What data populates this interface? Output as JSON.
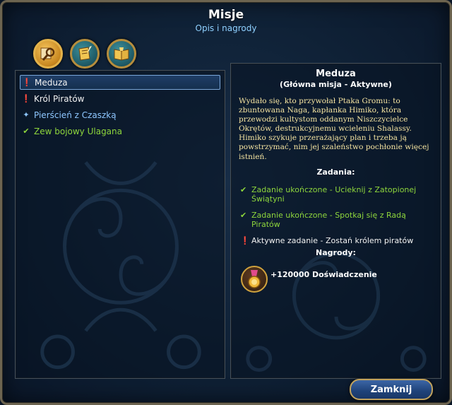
{
  "window": {
    "title": "Misje",
    "subtitle": "Opis i nagrody"
  },
  "tabs": [
    {
      "icon": "magnifier-map-icon",
      "active": true
    },
    {
      "icon": "scroll-quill-icon",
      "active": false
    },
    {
      "icon": "open-book-icon",
      "active": false
    }
  ],
  "quests": [
    {
      "label": "Meduza",
      "status": "active",
      "icon": "exclamation-icon",
      "color": "#f2f2f2",
      "selected": true
    },
    {
      "label": "Król Piratów",
      "status": "active",
      "icon": "exclamation-icon",
      "color": "#f2f2f2",
      "selected": false
    },
    {
      "label": "Pierścień z Czaszką",
      "status": "new",
      "icon": "branch-icon",
      "color": "#8ec7ff",
      "selected": false
    },
    {
      "label": "Zew bojowy Ulagana",
      "status": "completed",
      "icon": "checkmark-icon",
      "color": "#8ed63c",
      "selected": false
    }
  ],
  "detail": {
    "name": "Meduza",
    "type": "(Główna misja - Aktywne)",
    "description": "Wydało się, kto przywołał Ptaka Gromu: to zbuntowana Naga, kapłanka Himiko, która przewodzi kultystom oddanym Niszczycielce Okrętów, destrukcyjnemu wcieleniu Shalassy. Himiko szykuje przerażający plan i trzeba ją powstrzymać, nim jej szaleństwo pochłonie więcej istnień.",
    "tasks_title": "Zadania:",
    "tasks": [
      {
        "text": "Zadanie ukończone - Ucieknij z Zatopionej Świątyni",
        "state": "completed",
        "icon": "checkmark-icon",
        "color": "#8ed63c"
      },
      {
        "text": "Zadanie ukończone - Spotkaj się z Radą Piratów",
        "state": "completed",
        "icon": "checkmark-icon",
        "color": "#8ed63c"
      },
      {
        "text": "Aktywne zadanie - Zostań królem piratów",
        "state": "active",
        "icon": "exclamation-icon",
        "color": "#f2f2f2"
      }
    ],
    "rewards_title": "Nagrody:",
    "rewards": [
      {
        "text": "+120000 Doświadczenie",
        "icon": "experience-medal-icon"
      }
    ]
  },
  "buttons": {
    "close": "Zamknij"
  },
  "colors": {
    "accent_gold": "#c2a35d",
    "completed_green": "#8ed63c",
    "new_blue": "#8ec7ff",
    "description_yellow": "#f4e3a0",
    "subtitle_blue": "#8fd1ff"
  }
}
